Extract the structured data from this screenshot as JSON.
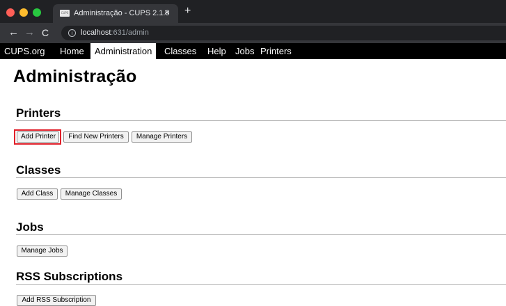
{
  "browser": {
    "tab_title": "Administração - CUPS 2.1.0",
    "tab_close": "×",
    "new_tab": "+",
    "favicon_text": "CUPS",
    "url_host": "localhost",
    "url_rest": ":631/admin",
    "back_icon": "←",
    "forward_icon": "→",
    "reload_icon": "C",
    "info_icon": "i"
  },
  "nav": {
    "items": [
      {
        "label": "CUPS.org"
      },
      {
        "label": "Home"
      },
      {
        "label": "Administration",
        "active": true
      },
      {
        "label": "Classes"
      },
      {
        "label": "Help"
      },
      {
        "label": "Jobs"
      },
      {
        "label": "Printers"
      }
    ]
  },
  "page": {
    "title": "Administração",
    "sections": {
      "printers": {
        "title": "Printers",
        "buttons": [
          "Add Printer",
          "Find New Printers",
          "Manage Printers"
        ]
      },
      "classes": {
        "title": "Classes",
        "buttons": [
          "Add Class",
          "Manage Classes"
        ]
      },
      "jobs": {
        "title": "Jobs",
        "buttons": [
          "Manage Jobs"
        ]
      },
      "rss": {
        "title": "RSS Subscriptions",
        "buttons": [
          "Add RSS Subscription"
        ]
      }
    }
  },
  "colors": {
    "highlight": "#e0202a",
    "nav_background": "#000000",
    "chrome_dark": "#202124"
  }
}
